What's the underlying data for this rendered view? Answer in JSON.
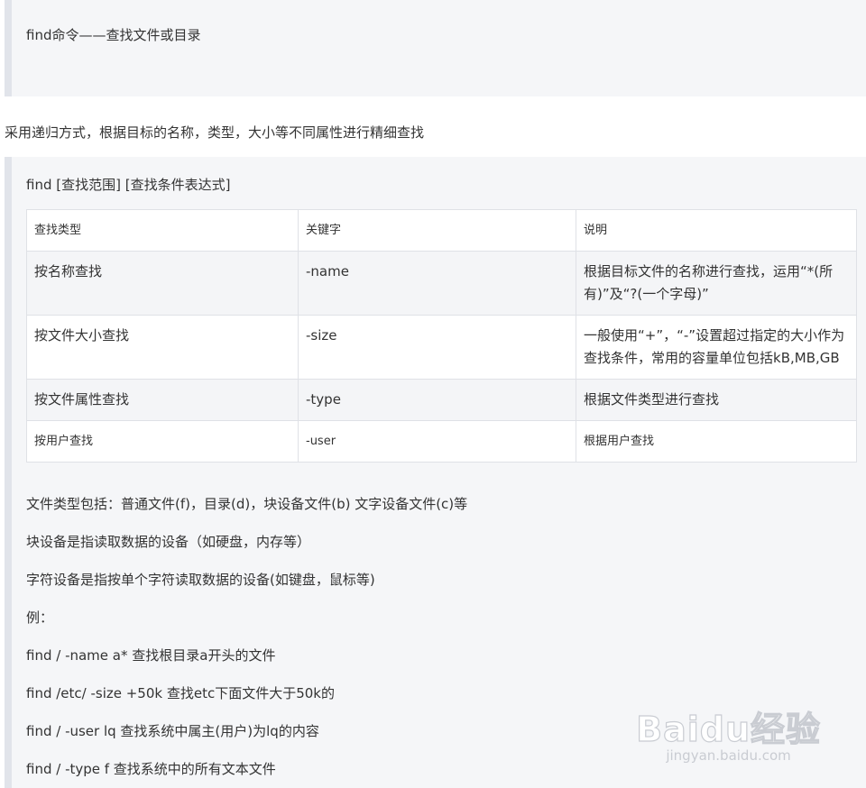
{
  "quote1": {
    "text": "find命令——查找文件或目录"
  },
  "intro": "采用递归方式，根据目标的名称，类型，大小等不同属性进行精细查找",
  "syntax": "find [查找范围]  [查找条件表达式]",
  "table": {
    "headers": [
      "查找类型",
      "关键字",
      "说明"
    ],
    "rows": [
      {
        "type": "按名称查找",
        "keyword": "-name",
        "desc": "根据目标文件的名称进行查找，运用“*(所有)”及“?(一个字母)”"
      },
      {
        "type": "按文件大小查找",
        "keyword": "-size",
        "desc": "一般使用“+”，“-”设置超过指定的大小作为查找条件，常用的容量单位包括kB,MB,GB"
      },
      {
        "type": "按文件属性查找",
        "keyword": "-type",
        "desc": "根据文件类型进行查找"
      },
      {
        "type": "按用户查找",
        "keyword": "-user",
        "desc": "根据用户查找"
      }
    ]
  },
  "paragraphs": [
    "文件类型包括：普通文件(f)，目录(d)，块设备文件(b) 文字设备文件(c)等",
    "块设备是指读取数据的设备（如硬盘，内存等）",
    "字符设备是指按单个字符读取数据的设备(如键盘，鼠标等)",
    "例：",
    "find / -name a* 查找根目录a开头的文件",
    "find /etc/ -size +50k 查找etc下面文件大于50k的",
    "find / -user lq 查找系统中属主(用户)为lq的内容",
    "find / -type f 查找系统中的所有文本文件"
  ],
  "watermark": {
    "brand": "Baidu经验",
    "url": "jingyan.baidu.com"
  }
}
